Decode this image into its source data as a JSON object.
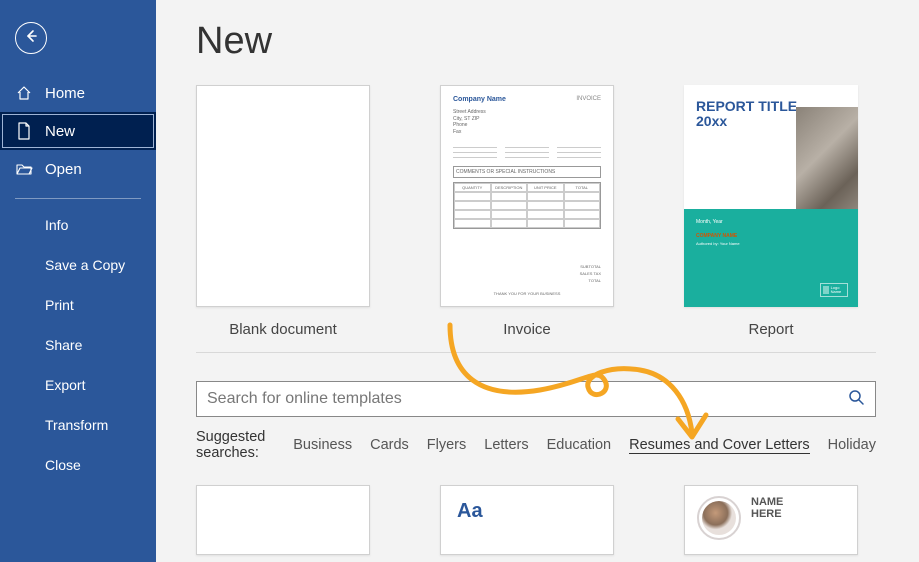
{
  "sidebar": {
    "primary": [
      {
        "label": "Home",
        "icon": "home-icon"
      },
      {
        "label": "New",
        "icon": "new-doc-icon"
      },
      {
        "label": "Open",
        "icon": "open-folder-icon"
      }
    ],
    "secondary": [
      {
        "label": "Info"
      },
      {
        "label": "Save a Copy"
      },
      {
        "label": "Print"
      },
      {
        "label": "Share"
      },
      {
        "label": "Export"
      },
      {
        "label": "Transform"
      },
      {
        "label": "Close"
      }
    ],
    "selected_index": 1
  },
  "page": {
    "title": "New"
  },
  "templates": [
    {
      "label": "Blank document"
    },
    {
      "label": "Invoice"
    },
    {
      "label": "Report"
    }
  ],
  "invoice_preview": {
    "company": "Company Name",
    "badge": "INVOICE",
    "headers": [
      "QUANTITY",
      "DESCRIPTION",
      "UNIT PRICE",
      "TOTAL"
    ],
    "footer_center": "THANK YOU FOR YOUR BUSINESS"
  },
  "report_preview": {
    "title_line1": "REPORT TITLE",
    "title_line2": "20xx",
    "subtitle": "Month, Year",
    "company": "COMPANY NAME",
    "author_line": "Authored by: Your Name",
    "logo_text": "Logo Name"
  },
  "search": {
    "placeholder": "Search for online templates"
  },
  "suggested": {
    "label": "Suggested searches:",
    "items": [
      "Business",
      "Cards",
      "Flyers",
      "Letters",
      "Education",
      "Resumes and Cover Letters",
      "Holiday"
    ],
    "highlight_index": 5
  },
  "peek_templates": {
    "aa_text": "Aa",
    "resume_name_line1": "NAME",
    "resume_name_line2": "HERE"
  },
  "colors": {
    "brand": "#2b579a",
    "selected_bg": "#002050",
    "teal": "#1aaf9e",
    "annotation": "#f5a623"
  }
}
